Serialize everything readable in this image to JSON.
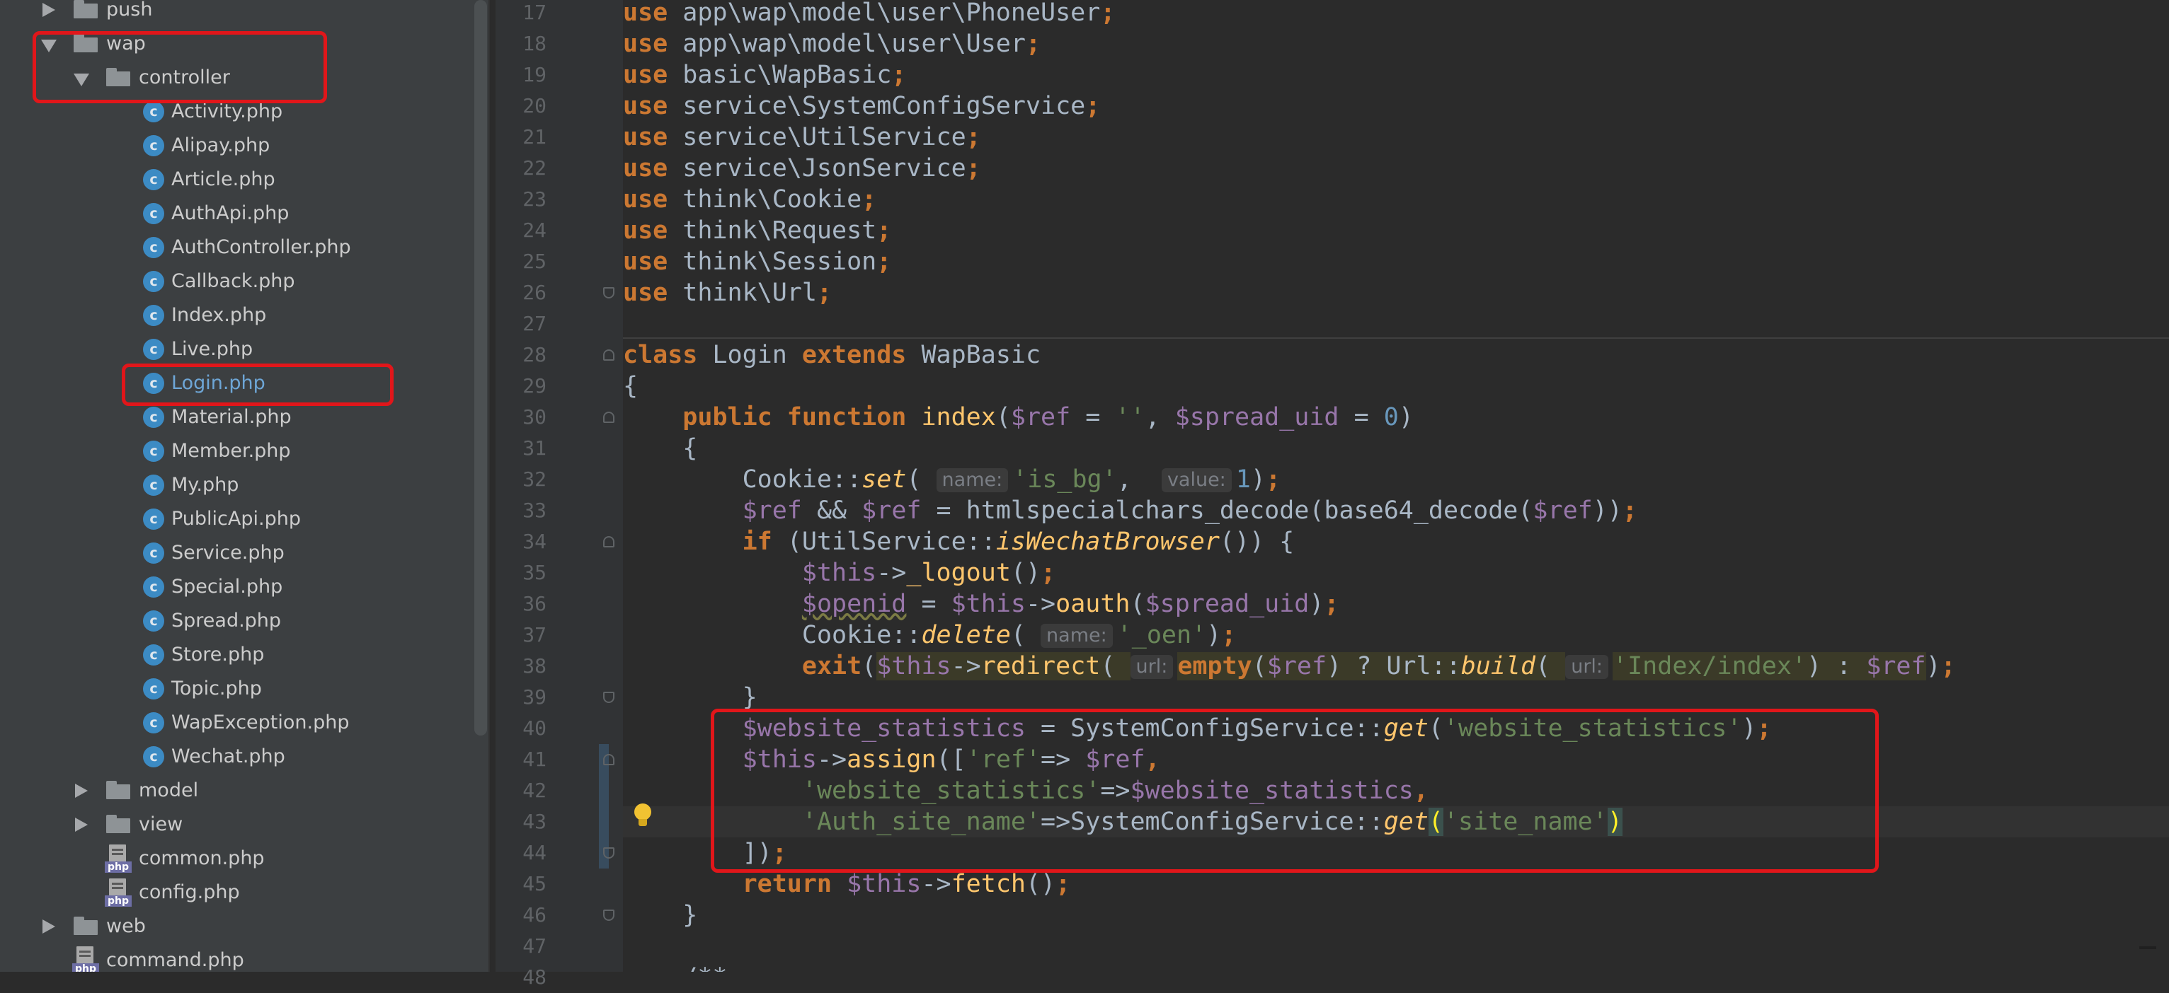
{
  "project_tree": {
    "items": [
      {
        "label": "push",
        "type": "folder",
        "expanded": false,
        "depth": 1
      },
      {
        "label": "wap",
        "type": "folder",
        "expanded": true,
        "depth": 1
      },
      {
        "label": "controller",
        "type": "folder",
        "expanded": true,
        "depth": 2
      },
      {
        "label": "Activity.php",
        "type": "class",
        "depth": 3
      },
      {
        "label": "Alipay.php",
        "type": "class",
        "depth": 3
      },
      {
        "label": "Article.php",
        "type": "class",
        "depth": 3
      },
      {
        "label": "AuthApi.php",
        "type": "class",
        "depth": 3
      },
      {
        "label": "AuthController.php",
        "type": "class",
        "depth": 3
      },
      {
        "label": "Callback.php",
        "type": "class",
        "depth": 3
      },
      {
        "label": "Index.php",
        "type": "class",
        "depth": 3
      },
      {
        "label": "Live.php",
        "type": "class",
        "depth": 3
      },
      {
        "label": "Login.php",
        "type": "class",
        "depth": 3,
        "selected": true
      },
      {
        "label": "Material.php",
        "type": "class",
        "depth": 3
      },
      {
        "label": "Member.php",
        "type": "class",
        "depth": 3
      },
      {
        "label": "My.php",
        "type": "class",
        "depth": 3
      },
      {
        "label": "PublicApi.php",
        "type": "class",
        "depth": 3
      },
      {
        "label": "Service.php",
        "type": "class",
        "depth": 3
      },
      {
        "label": "Special.php",
        "type": "class",
        "depth": 3
      },
      {
        "label": "Spread.php",
        "type": "class",
        "depth": 3
      },
      {
        "label": "Store.php",
        "type": "class",
        "depth": 3
      },
      {
        "label": "Topic.php",
        "type": "class",
        "depth": 3
      },
      {
        "label": "WapException.php",
        "type": "class",
        "depth": 3
      },
      {
        "label": "Wechat.php",
        "type": "class",
        "depth": 3
      },
      {
        "label": "model",
        "type": "folder",
        "expanded": false,
        "depth": 2
      },
      {
        "label": "view",
        "type": "folder",
        "expanded": false,
        "depth": 2
      },
      {
        "label": "common.php",
        "type": "php",
        "depth": 2
      },
      {
        "label": "config.php",
        "type": "php",
        "depth": 2
      },
      {
        "label": "web",
        "type": "folder",
        "expanded": false,
        "depth": 1
      },
      {
        "label": "command.php",
        "type": "php",
        "depth": 1
      }
    ],
    "class_icon_letter": "c",
    "php_icon_label": "php"
  },
  "editor": {
    "first_line": 17,
    "current_line": 43,
    "lines": [
      [
        [
          "kw",
          "use"
        ],
        [
          "t",
          " app\\wap\\model\\user\\PhoneUser"
        ],
        [
          "kw",
          ";"
        ]
      ],
      [
        [
          "kw",
          "use"
        ],
        [
          "t",
          " app\\wap\\model\\user\\User"
        ],
        [
          "kw",
          ";"
        ]
      ],
      [
        [
          "kw",
          "use"
        ],
        [
          "t",
          " basic\\WapBasic"
        ],
        [
          "kw",
          ";"
        ]
      ],
      [
        [
          "kw",
          "use"
        ],
        [
          "t",
          " service\\SystemConfigService"
        ],
        [
          "kw",
          ";"
        ]
      ],
      [
        [
          "kw",
          "use"
        ],
        [
          "t",
          " service\\UtilService"
        ],
        [
          "kw",
          ";"
        ]
      ],
      [
        [
          "kw",
          "use"
        ],
        [
          "t",
          " service\\JsonService"
        ],
        [
          "kw",
          ";"
        ]
      ],
      [
        [
          "kw",
          "use"
        ],
        [
          "t",
          " think\\Cookie"
        ],
        [
          "kw",
          ";"
        ]
      ],
      [
        [
          "kw",
          "use"
        ],
        [
          "t",
          " think\\Request"
        ],
        [
          "kw",
          ";"
        ]
      ],
      [
        [
          "kw",
          "use"
        ],
        [
          "t",
          " think\\Session"
        ],
        [
          "kw",
          ";"
        ]
      ],
      [
        [
          "kw",
          "use"
        ],
        [
          "t",
          " think\\Url"
        ],
        [
          "kw",
          ";"
        ]
      ],
      [],
      [
        [
          "kw",
          "class"
        ],
        [
          "t",
          " Login "
        ],
        [
          "kw",
          "extends"
        ],
        [
          "t",
          " WapBasic"
        ]
      ],
      [
        [
          "t",
          "{"
        ]
      ],
      [
        [
          "t",
          "    "
        ],
        [
          "kw",
          "public function"
        ],
        [
          "t",
          " "
        ],
        [
          "fn",
          "index"
        ],
        [
          "t",
          "("
        ],
        [
          "var",
          "$ref"
        ],
        [
          "t",
          " = "
        ],
        [
          "str",
          "''"
        ],
        [
          "t",
          ", "
        ],
        [
          "var",
          "$spread_uid"
        ],
        [
          "t",
          " = "
        ],
        [
          "num",
          "0"
        ],
        [
          "t",
          ")"
        ]
      ],
      [
        [
          "t",
          "    {"
        ]
      ],
      [
        [
          "t",
          "        Cookie::"
        ],
        [
          "sfn",
          "set"
        ],
        [
          "t",
          "( "
        ],
        [
          "hint",
          "name:"
        ],
        [
          "str",
          "'is_bg'"
        ],
        [
          "t",
          ",  "
        ],
        [
          "hint",
          "value:"
        ],
        [
          "num",
          "1"
        ],
        [
          "t",
          ")"
        ],
        [
          "kw",
          ";"
        ]
      ],
      [
        [
          "t",
          "        "
        ],
        [
          "var",
          "$ref"
        ],
        [
          "t",
          " && "
        ],
        [
          "var",
          "$ref"
        ],
        [
          "t",
          " = htmlspecialchars_decode(base64_decode("
        ],
        [
          "var",
          "$ref"
        ],
        [
          "t",
          "))"
        ],
        [
          "kw",
          ";"
        ]
      ],
      [
        [
          "t",
          "        "
        ],
        [
          "kw",
          "if"
        ],
        [
          "t",
          " (UtilService::"
        ],
        [
          "sfn",
          "isWechatBrowser"
        ],
        [
          "t",
          "()) {"
        ]
      ],
      [
        [
          "t",
          "            "
        ],
        [
          "var",
          "$this"
        ],
        [
          "t",
          "->"
        ],
        [
          "fn",
          "_logout"
        ],
        [
          "t",
          "()"
        ],
        [
          "kw",
          ";"
        ]
      ],
      [
        [
          "t",
          "            "
        ],
        [
          "warnvar",
          "$openid"
        ],
        [
          "t",
          " = "
        ],
        [
          "var",
          "$this"
        ],
        [
          "t",
          "->"
        ],
        [
          "fn",
          "oauth"
        ],
        [
          "t",
          "("
        ],
        [
          "var",
          "$spread_uid"
        ],
        [
          "t",
          ")"
        ],
        [
          "kw",
          ";"
        ]
      ],
      [
        [
          "t",
          "            Cookie::"
        ],
        [
          "sfn",
          "delete"
        ],
        [
          "t",
          "( "
        ],
        [
          "hint",
          "name:"
        ],
        [
          "str",
          "'_oen'"
        ],
        [
          "t",
          ")"
        ],
        [
          "kw",
          ";"
        ]
      ],
      [
        [
          "t",
          "            "
        ],
        [
          "kw",
          "exit"
        ],
        [
          "t",
          "("
        ],
        [
          "hlvar",
          "$this"
        ],
        [
          "hl",
          "->"
        ],
        [
          "hlfn",
          "redirect"
        ],
        [
          "hl",
          "( "
        ],
        [
          "hint",
          "url:"
        ],
        [
          "hlkw",
          "empty"
        ],
        [
          "hl",
          "("
        ],
        [
          "hlvar",
          "$ref"
        ],
        [
          "hl",
          ") ? Url::"
        ],
        [
          "hlsfn",
          "build"
        ],
        [
          "hl",
          "( "
        ],
        [
          "hint",
          "url:"
        ],
        [
          "hlstr",
          "'Index/index'"
        ],
        [
          "hl",
          ") : "
        ],
        [
          "hlvar",
          "$ref"
        ],
        [
          "t",
          ")"
        ],
        [
          "kw",
          ";"
        ]
      ],
      [
        [
          "t",
          "        }"
        ]
      ],
      [
        [
          "t",
          "        "
        ],
        [
          "var",
          "$website_statistics"
        ],
        [
          "t",
          " = SystemConfigService::"
        ],
        [
          "sfn",
          "get"
        ],
        [
          "t",
          "("
        ],
        [
          "str",
          "'website_statistics'"
        ],
        [
          "t",
          ")"
        ],
        [
          "kw",
          ";"
        ]
      ],
      [
        [
          "t",
          "        "
        ],
        [
          "var",
          "$this"
        ],
        [
          "t",
          "->"
        ],
        [
          "fn",
          "assign"
        ],
        [
          "t",
          "(["
        ],
        [
          "str",
          "'ref'"
        ],
        [
          "t",
          "=> "
        ],
        [
          "var",
          "$ref"
        ],
        [
          "kw",
          ","
        ]
      ],
      [
        [
          "t",
          "            "
        ],
        [
          "str",
          "'website_statistics'"
        ],
        [
          "t",
          "=>"
        ],
        [
          "var",
          "$website_statistics"
        ],
        [
          "kw",
          ","
        ]
      ],
      [
        [
          "t",
          "            "
        ],
        [
          "str",
          "'Auth_site_name'"
        ],
        [
          "t",
          "=>SystemConfigService::"
        ],
        [
          "sfn",
          "get"
        ],
        [
          "bm",
          "("
        ],
        [
          "str",
          "'site_name'"
        ],
        [
          "bm",
          ")"
        ]
      ],
      [
        [
          "t",
          "        ])"
        ],
        [
          "kw",
          ";"
        ]
      ],
      [
        [
          "t",
          "        "
        ],
        [
          "kw",
          "return"
        ],
        [
          "t",
          " "
        ],
        [
          "var",
          "$this"
        ],
        [
          "t",
          "->"
        ],
        [
          "fn",
          "fetch"
        ],
        [
          "t",
          "()"
        ],
        [
          "kw",
          ";"
        ]
      ],
      [
        [
          "t",
          "    }"
        ]
      ],
      [],
      [
        [
          "t",
          "    /**"
        ]
      ]
    ]
  },
  "colors": {
    "keyword": "#cc7832",
    "variable": "#9876aa",
    "function": "#ffc66d",
    "string": "#6a8759",
    "number": "#6897bb",
    "text": "#a9b7c6",
    "editor_bg": "#2b2b2b",
    "tree_bg": "#3c3f41",
    "annotation": "#e1161a"
  }
}
